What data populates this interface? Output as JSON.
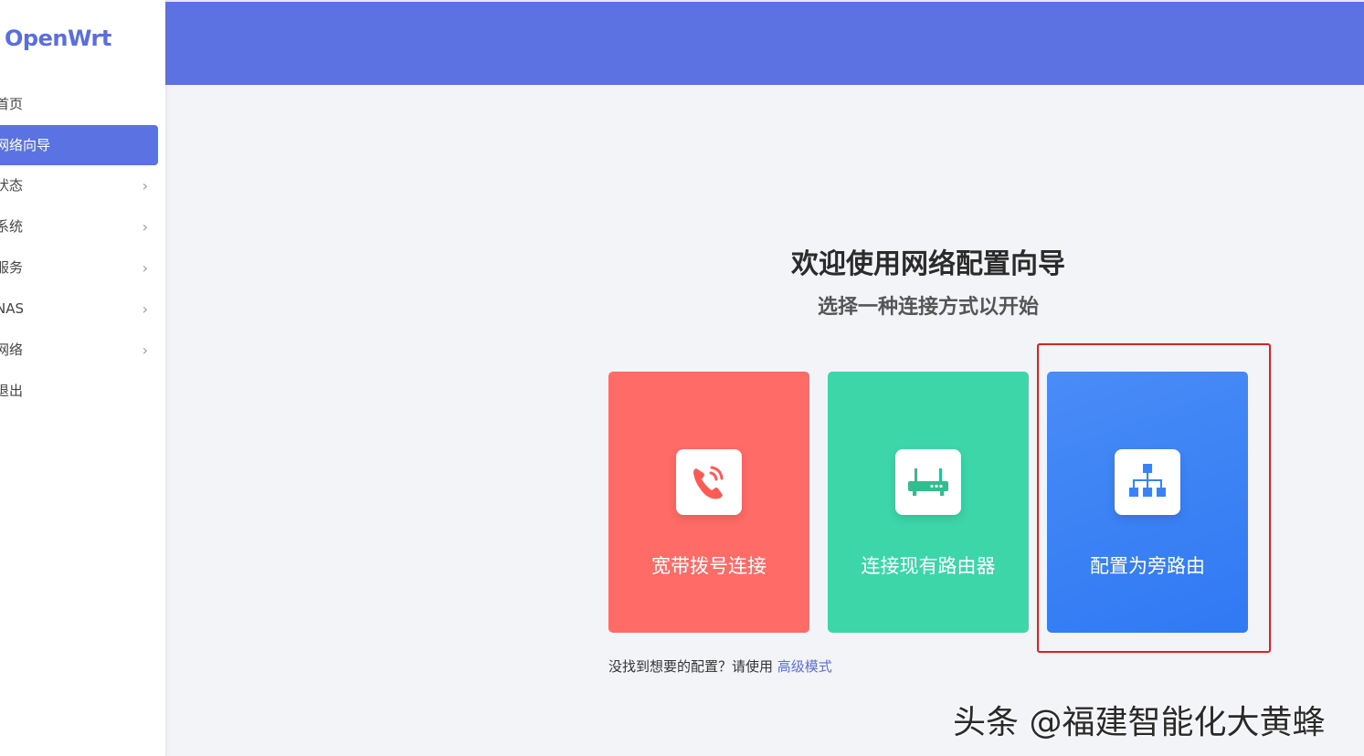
{
  "app": {
    "logo": "OpenWrt"
  },
  "sidebar": {
    "items": [
      {
        "label": "首页",
        "active": false,
        "has_children": false
      },
      {
        "label": "网络向导",
        "active": true,
        "has_children": false
      },
      {
        "label": "状态",
        "active": false,
        "has_children": true
      },
      {
        "label": "系统",
        "active": false,
        "has_children": true
      },
      {
        "label": "服务",
        "active": false,
        "has_children": true
      },
      {
        "label": "NAS",
        "active": false,
        "has_children": true
      },
      {
        "label": "网络",
        "active": false,
        "has_children": true
      },
      {
        "label": "退出",
        "active": false,
        "has_children": false
      }
    ],
    "chevron": "›"
  },
  "main": {
    "title": "欢迎使用网络配置向导",
    "subtitle": "选择一种连接方式以开始",
    "cards": [
      {
        "label": "宽带拨号连接",
        "icon": "phone-icon",
        "color": "#ff6b66"
      },
      {
        "label": "连接现有路由器",
        "icon": "router-icon",
        "color": "#3dd6a9"
      },
      {
        "label": "配置为旁路由",
        "icon": "network-tree-icon",
        "color": "#2f79f3"
      }
    ],
    "footer_text": "没找到想要的配置？请使用",
    "footer_link": "高级模式"
  },
  "watermark": "头条 @福建智能化大黄蜂",
  "colors": {
    "accent": "#5d72e2",
    "highlight_box": "#e02020"
  }
}
